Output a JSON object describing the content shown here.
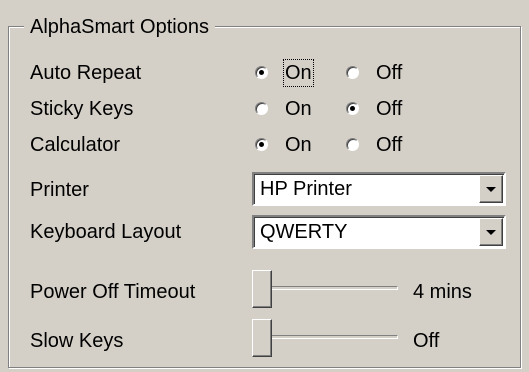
{
  "group": {
    "title": "AlphaSmart Options"
  },
  "options": [
    {
      "label": "Auto Repeat",
      "on_label": "On",
      "off_label": "Off",
      "selected": "on",
      "focused": "on"
    },
    {
      "label": "Sticky Keys",
      "on_label": "On",
      "off_label": "Off",
      "selected": "off"
    },
    {
      "label": "Calculator",
      "on_label": "On",
      "off_label": "Off",
      "selected": "on"
    }
  ],
  "printer": {
    "label": "Printer",
    "value": "HP Printer"
  },
  "keyboard_layout": {
    "label": "Keyboard Layout",
    "value": "QWERTY"
  },
  "power_off_timeout": {
    "label": "Power Off Timeout",
    "value_text": "4 mins",
    "level": 0
  },
  "slow_keys": {
    "label": "Slow Keys",
    "value_text": "Off",
    "level": 0
  }
}
